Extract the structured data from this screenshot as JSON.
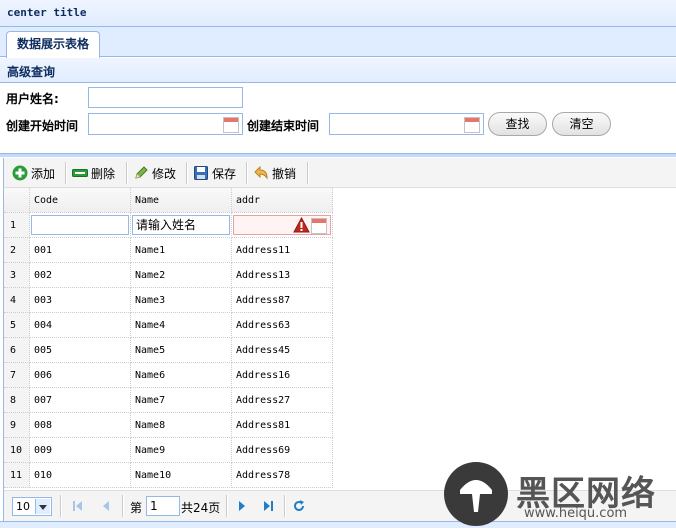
{
  "window": {
    "title": "center title"
  },
  "tabs": [
    {
      "label": "数据展示表格"
    }
  ],
  "search": {
    "title": "高级查询",
    "username_label": "用户姓名:",
    "username_value": "",
    "start_label": "创建开始时间",
    "start_value": "",
    "end_label": "创建结束时间",
    "end_value": "",
    "find_label": "查找",
    "clear_label": "清空"
  },
  "toolbar": {
    "add": "添加",
    "delete": "删除",
    "edit": "修改",
    "save": "保存",
    "undo": "撤销"
  },
  "grid": {
    "columns": [
      "Code",
      "Name",
      "addr"
    ],
    "edit_row": {
      "num": "1",
      "code": "",
      "name": "请输入姓名",
      "addr": ""
    },
    "rows": [
      {
        "num": "2",
        "code": "001",
        "name": "Name1",
        "addr": "Address11"
      },
      {
        "num": "3",
        "code": "002",
        "name": "Name2",
        "addr": "Address13"
      },
      {
        "num": "4",
        "code": "003",
        "name": "Name3",
        "addr": "Address87"
      },
      {
        "num": "5",
        "code": "004",
        "name": "Name4",
        "addr": "Address63"
      },
      {
        "num": "6",
        "code": "005",
        "name": "Name5",
        "addr": "Address45"
      },
      {
        "num": "7",
        "code": "006",
        "name": "Name6",
        "addr": "Address16"
      },
      {
        "num": "8",
        "code": "007",
        "name": "Name7",
        "addr": "Address27"
      },
      {
        "num": "9",
        "code": "008",
        "name": "Name8",
        "addr": "Address81"
      },
      {
        "num": "10",
        "code": "009",
        "name": "Name9",
        "addr": "Address69"
      },
      {
        "num": "11",
        "code": "010",
        "name": "Name10",
        "addr": "Address78"
      }
    ]
  },
  "pager": {
    "page_size": "10",
    "page_prefix": "第",
    "page_value": "1",
    "page_total": "共24页"
  },
  "watermark": {
    "brand": "黑区网络",
    "url": "www.heiqu.com"
  },
  "colors": {
    "border": "#95b8e7",
    "header_bg": "#e0ecff",
    "accent_blue": "#1e7ec8",
    "add_green": "#2a9c3a"
  }
}
